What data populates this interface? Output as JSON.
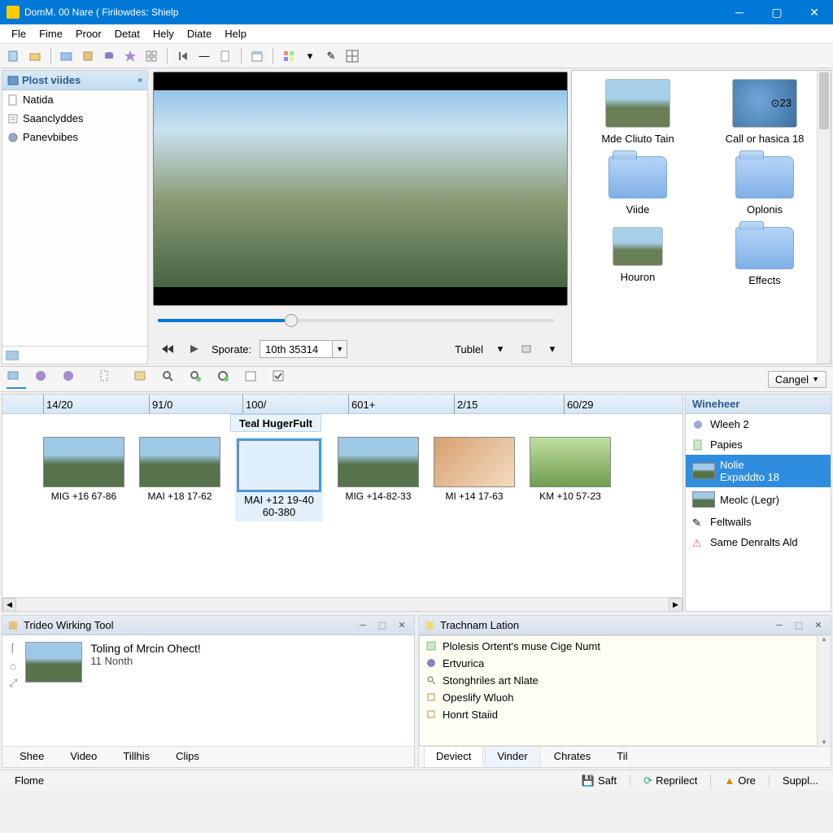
{
  "window": {
    "title": "DomM. 00 Nare ( Firilowdes: Shielp"
  },
  "menu": [
    "Fle",
    "Fime",
    "Proor",
    "Detat",
    "Hely",
    "Diate",
    "Help"
  ],
  "sidebar": {
    "header": "Plost viides",
    "items": [
      "Natida",
      "Saanclyddes",
      "Panevbibes"
    ]
  },
  "preview": {
    "sporate_label": "Sporate:",
    "sporate_value": "10th 35314",
    "tubl_label": "Tublel"
  },
  "library": {
    "items": [
      {
        "label": "Mde Cliuto Tain",
        "type": "thumb-landscape"
      },
      {
        "label": "Call or hasica 18",
        "type": "thumb-camera",
        "badge": "⊙23"
      },
      {
        "label": "Viide",
        "type": "folder"
      },
      {
        "label": "Oplonis",
        "type": "folder"
      },
      {
        "label": "Houron",
        "type": "thumb-landscape-small"
      },
      {
        "label": "Effects",
        "type": "folder"
      }
    ]
  },
  "cancel_btn": "Cangel",
  "timeline": {
    "ticks": [
      "14/20",
      "91/0",
      "100/",
      "601+",
      "2/15",
      "60/29"
    ],
    "selected_label": "Teal HugerFult",
    "clips": [
      {
        "name": "MIG +16 67-86",
        "type": "mtn"
      },
      {
        "name": "MAI +18 17-62",
        "type": "mtn"
      },
      {
        "name": "MAI +12 19-40",
        "name2": "60-380",
        "type": "sunset",
        "selected": true
      },
      {
        "name": "MIG +14-82-33",
        "type": "mtn"
      },
      {
        "name": "MI +14 17-63",
        "type": "portrait"
      },
      {
        "name": "KM +10 57-23",
        "type": "green"
      }
    ]
  },
  "timeline_side": {
    "header": "Wineheer",
    "items": [
      {
        "label": "Wleeh 2",
        "icon": "globe"
      },
      {
        "label": "Papies",
        "icon": "doc"
      },
      {
        "label": "Nolie",
        "label2": "Expaddto 18",
        "icon": "thumb",
        "selected": true
      },
      {
        "label": "Meolc (Legr)",
        "icon": "thumb"
      },
      {
        "label": "Feltwalls",
        "icon": "pen"
      },
      {
        "label": "Same Denralts Ald",
        "icon": "warn"
      }
    ]
  },
  "panel_left": {
    "title": "Trideo Wirking Tool",
    "entry": {
      "title": "Toling of Mrcin Ohect!",
      "sub": "11 Nonth"
    }
  },
  "panel_right": {
    "title": "Trachnam Lation",
    "log": [
      "Plolesis Ortent's muse Cige Numt",
      "Ertvurica",
      "Stonghriles art Nlate",
      "Opeslify Wluoh",
      "Honrt Staiid"
    ],
    "tabs": [
      "Deviect",
      "Vinder",
      "Chrates",
      "Til"
    ]
  },
  "bottom_tabs": [
    "Shee",
    "Video",
    "Tillhis",
    "Clips"
  ],
  "status": {
    "home": "Flome",
    "cells": [
      "Saft",
      "Reprilect",
      "Ore",
      "Suppl..."
    ]
  }
}
